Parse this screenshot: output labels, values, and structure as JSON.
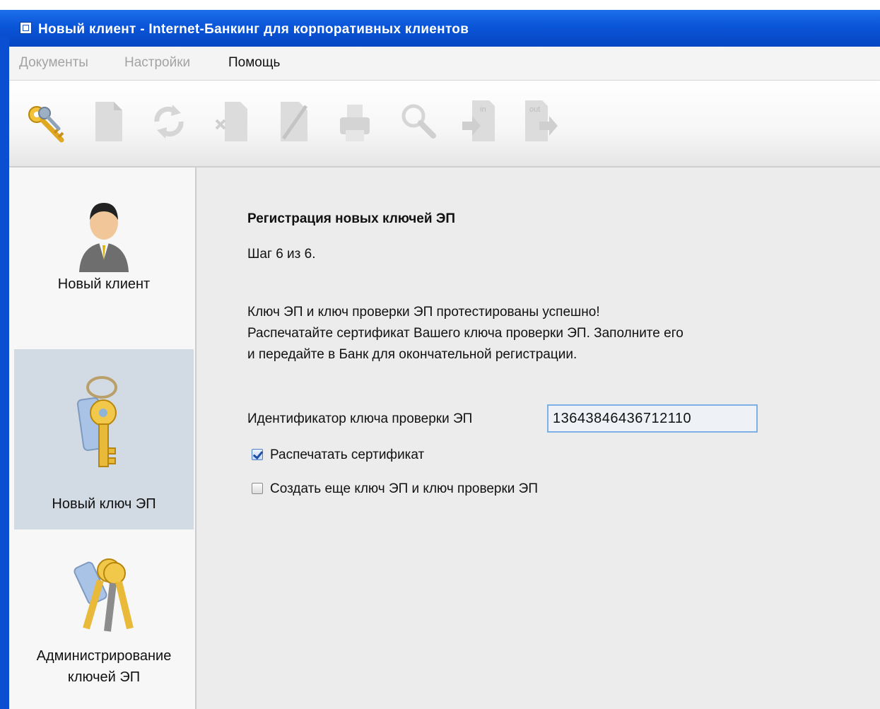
{
  "window": {
    "title": "Новый клиент - Internet-Банкинг для корпоративных клиентов"
  },
  "menu": {
    "items": [
      {
        "label": "Документы",
        "enabled": false
      },
      {
        "label": "Настройки",
        "enabled": false
      },
      {
        "label": "Помощь",
        "enabled": true
      }
    ]
  },
  "toolbar": {
    "buttons": [
      {
        "icon": "keys-icon",
        "enabled": true
      },
      {
        "icon": "new-document-icon",
        "enabled": false
      },
      {
        "icon": "refresh-icon",
        "enabled": false
      },
      {
        "icon": "delete-document-icon",
        "enabled": false
      },
      {
        "icon": "edit-document-icon",
        "enabled": false
      },
      {
        "icon": "printer-icon",
        "enabled": false
      },
      {
        "icon": "search-icon",
        "enabled": false
      },
      {
        "icon": "import-icon",
        "label": "in",
        "enabled": false
      },
      {
        "icon": "export-icon",
        "label": "out",
        "enabled": false
      }
    ]
  },
  "sidebar": {
    "items": [
      {
        "label": "Новый клиент",
        "icon": "user-icon",
        "selected": false
      },
      {
        "label": "Новый ключ ЭП",
        "icon": "key-icon",
        "selected": true
      },
      {
        "label_line1": "Администрирование",
        "label_line2": "ключей ЭП",
        "icon": "keys-bundle-icon",
        "selected": false
      }
    ]
  },
  "content": {
    "heading": "Регистрация новых ключей ЭП",
    "step": "Шаг 6 из 6.",
    "message_line1": "Ключ ЭП и ключ проверки ЭП протестированы успешно!",
    "message_line2": "Распечатайте сертификат Вашего ключа проверки ЭП. Заполните его",
    "message_line3": "и передайте в Банк для окончательной регистрации.",
    "id_label": "Идентификатор ключа проверки ЭП",
    "id_value": "13643846436712110",
    "print_checkbox": {
      "label": "Распечатать сертификат",
      "checked": true
    },
    "create_checkbox": {
      "label": "Создать еще ключ ЭП и ключ проверки ЭП",
      "checked": false
    }
  },
  "colors": {
    "titlebar": "#0a55d8",
    "selected_nav": "#d2dae3",
    "field_border": "#7eb0e6"
  }
}
